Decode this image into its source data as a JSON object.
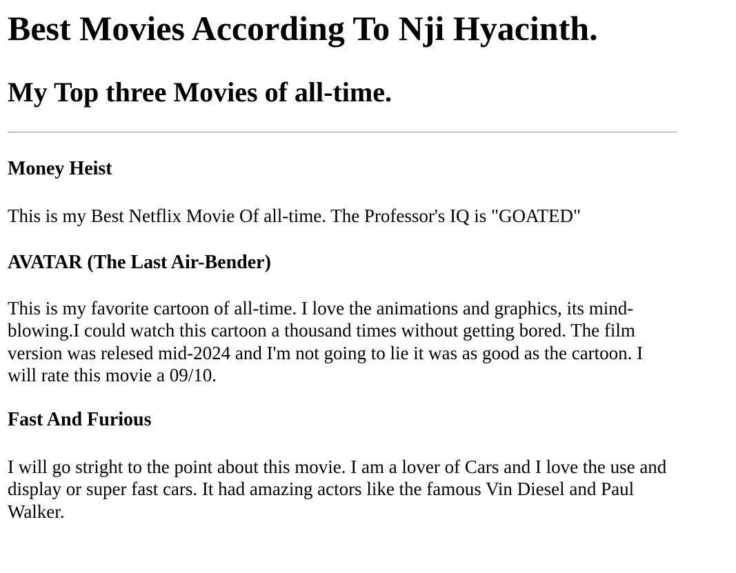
{
  "page": {
    "title": "Best Movies According To Nji Hyacinth.",
    "subtitle": "My Top three Movies of all-time."
  },
  "movies": [
    {
      "name": "Money Heist",
      "description": "This is my Best Netflix Movie Of all-time. The Professor's IQ is \"GOATED\""
    },
    {
      "name": "AVATAR (The Last Air-Bender)",
      "description": "This is my favorite cartoon of all-time. I love the animations and graphics, its mind-blowing.I could watch this cartoon a thousand times without getting bored. The film version was relesed mid-2024 and I'm not going to lie it was as good as the cartoon. I will rate this movie a 09/10."
    },
    {
      "name": "Fast And Furious",
      "description": "I will go stright to the point about this movie. I am a lover of Cars and I love the use and display or super fast cars. It had amazing actors like the famous Vin Diesel and Paul Walker."
    }
  ]
}
